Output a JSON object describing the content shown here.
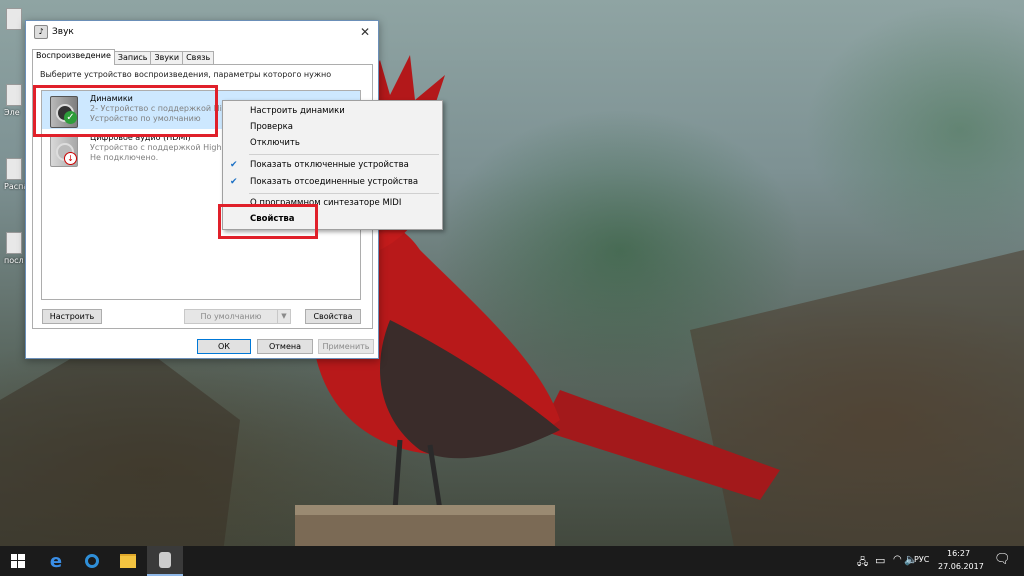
{
  "dialog": {
    "title": "Звук",
    "tabs": [
      "Воспроизведение",
      "Запись",
      "Звуки",
      "Связь"
    ],
    "instruction": "Выберите устройство воспроизведения, параметры которого нужно изменить:",
    "devices": [
      {
        "name": "Динамики",
        "line2": "2- Устройство с поддержкой High",
        "line3": "Устройство по умолчанию"
      },
      {
        "name": "Цифровое аудио (HDMI)",
        "line2": "Устройство с поддержкой High D",
        "line3": "Не подключено."
      }
    ],
    "buttons": {
      "configure": "Настроить",
      "set_default": "По умолчанию",
      "properties": "Свойства",
      "ok": "ОК",
      "cancel": "Отмена",
      "apply": "Применить"
    }
  },
  "context_menu": {
    "items": [
      {
        "label": "Настроить динамики",
        "checked": false
      },
      {
        "label": "Проверка",
        "checked": false
      },
      {
        "label": "Отключить",
        "checked": false
      },
      {
        "label": "Показать отключенные устройства",
        "checked": true
      },
      {
        "label": "Показать отсоединенные устройства",
        "checked": true
      },
      {
        "label": "О программном синтезаторе MIDI",
        "checked": false
      },
      {
        "label": "Свойства",
        "checked": false
      }
    ]
  },
  "desktop": {
    "icon_labels": [
      "Эле",
      "Распа",
      "посл"
    ]
  },
  "taskbar": {
    "language": "РУС",
    "time": "16:27",
    "date": "27.06.2017"
  },
  "colors": {
    "highlight": "#e0202a",
    "selection": "#cde8ff",
    "taskbar": "#1b1b1b"
  }
}
